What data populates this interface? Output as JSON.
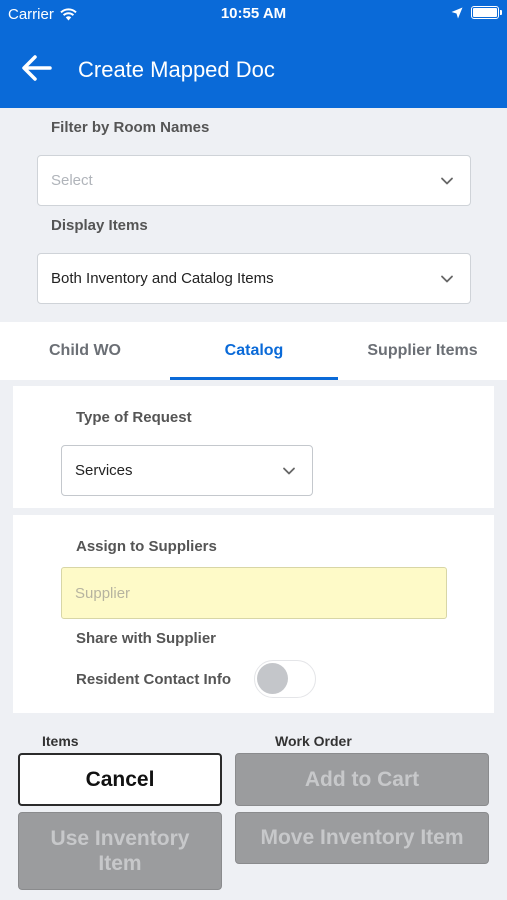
{
  "status_bar": {
    "carrier": "Carrier",
    "time": "10:55 AM"
  },
  "header": {
    "title": "Create Mapped Doc"
  },
  "filter": {
    "room_label": "Filter by Room Names",
    "room_placeholder": "Select",
    "display_label": "Display Items",
    "display_value": "Both Inventory and Catalog Items"
  },
  "tabs": [
    {
      "label": "Child WO",
      "active": false
    },
    {
      "label": "Catalog",
      "active": true
    },
    {
      "label": "Supplier Items",
      "active": false
    }
  ],
  "request": {
    "label": "Type of Request",
    "value": "Services"
  },
  "assign": {
    "label": "Assign to Suppliers",
    "supplier_placeholder": "Supplier",
    "share_label": "Share with Supplier",
    "resident_label": "Resident Contact Info",
    "resident_on": false
  },
  "list_headers": {
    "items": "Items",
    "work_order": "Work Order"
  },
  "actions": {
    "cancel": "Cancel",
    "add_to_cart": "Add to Cart",
    "use_inventory": "Use Inventory Item",
    "move_inventory": "Move Inventory Item"
  },
  "colors": {
    "brand": "#0a6ad8",
    "supplier_field": "#fefac8",
    "disabled_button": "#9b9c9e"
  },
  "icons": [
    "wifi-icon",
    "location-arrow-icon",
    "battery-icon",
    "back-arrow-icon",
    "chevron-down-icon"
  ]
}
